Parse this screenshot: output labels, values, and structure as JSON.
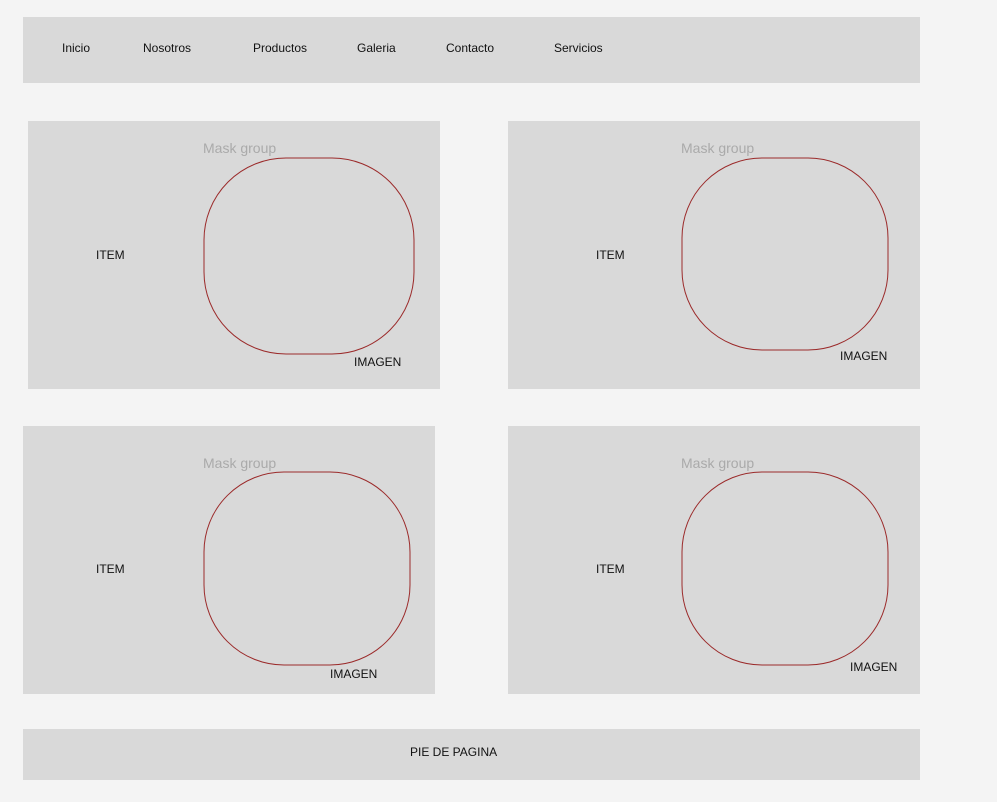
{
  "nav": {
    "items": [
      {
        "label": "Inicio"
      },
      {
        "label": "Nosotros"
      },
      {
        "label": "Productos"
      },
      {
        "label": "Galeria"
      },
      {
        "label": "Contacto"
      },
      {
        "label": "Servicios"
      }
    ]
  },
  "cards": [
    {
      "item_label": "ITEM",
      "mask_label": "Mask group",
      "image_label": "IMAGEN"
    },
    {
      "item_label": "ITEM",
      "mask_label": "Mask group",
      "image_label": "IMAGEN"
    },
    {
      "item_label": "ITEM",
      "mask_label": "Mask group",
      "image_label": "IMAGEN"
    },
    {
      "item_label": "ITEM",
      "mask_label": "Mask group",
      "image_label": "IMAGEN"
    }
  ],
  "footer": {
    "label": "PIE DE PAGINA"
  },
  "colors": {
    "background": "#f4f4f4",
    "panel": "#d9d9d9",
    "shape_stroke": "#9b2a2a",
    "mask_label": "#aaaaaa"
  }
}
